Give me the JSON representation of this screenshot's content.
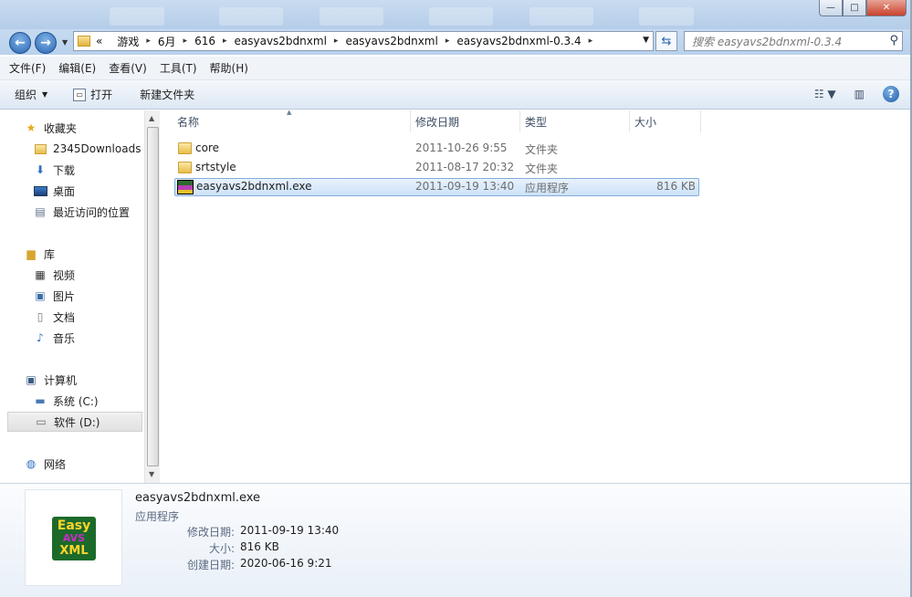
{
  "window": {
    "minimize_label": "—",
    "maximize_label": "□",
    "close_label": "✕"
  },
  "address": {
    "back_icon": "left-arrow-icon",
    "forward_icon": "right-arrow-icon",
    "overflow": "«",
    "crumbs": [
      "游戏",
      "6月",
      "616",
      "easyavs2bdnxml",
      "easyavs2bdnxml",
      "easyavs2bdnxml-0.3.4"
    ],
    "separator": "▸",
    "search_placeholder": "搜索 easyavs2bdnxml-0.3.4"
  },
  "menu": [
    "文件(F)",
    "编辑(E)",
    "查看(V)",
    "工具(T)",
    "帮助(H)"
  ],
  "toolbar": {
    "organize": "组织",
    "open": "打开",
    "new_folder": "新建文件夹"
  },
  "sidebar": {
    "favorites": "收藏夹",
    "fav_items": [
      "2345Downloads",
      "下载",
      "桌面",
      "最近访问的位置"
    ],
    "libraries": "库",
    "lib_items": [
      "视频",
      "图片",
      "文档",
      "音乐"
    ],
    "computer": "计算机",
    "drives": [
      "系统 (C:)",
      "软件 (D:)"
    ],
    "network": "网络"
  },
  "columns": {
    "name": "名称",
    "modified": "修改日期",
    "type": "类型",
    "size": "大小"
  },
  "files": [
    {
      "name": "core",
      "modified": "2011-10-26 9:55",
      "type": "文件夹",
      "size": ""
    },
    {
      "name": "srtstyle",
      "modified": "2011-08-17 20:32",
      "type": "文件夹",
      "size": ""
    },
    {
      "name": "easyavs2bdnxml.exe",
      "modified": "2011-09-19 13:40",
      "type": "应用程序",
      "size": "816 KB"
    }
  ],
  "details": {
    "name": "easyavs2bdnxml.exe",
    "type": "应用程序",
    "icon_text": [
      "Easy",
      "AVS",
      "XML"
    ],
    "fields": [
      {
        "label": "修改日期:",
        "value": "2011-09-19 13:40"
      },
      {
        "label": "大小:",
        "value": "816 KB"
      },
      {
        "label": "创建日期:",
        "value": "2020-06-16 9:21"
      }
    ]
  }
}
